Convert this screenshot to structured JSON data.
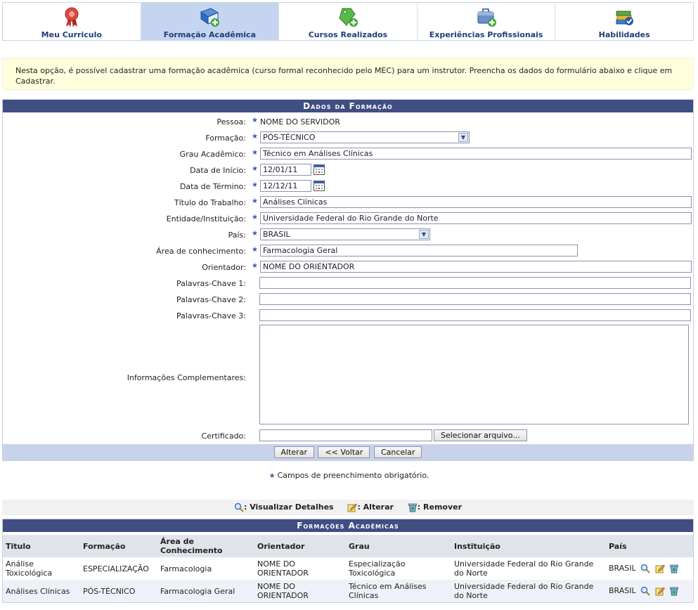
{
  "tabs": [
    {
      "label": "Meu Curriculo",
      "icon": "ribbon-award-icon",
      "active": false
    },
    {
      "label": "Formação Acadêmica",
      "icon": "book-add-icon",
      "active": true
    },
    {
      "label": "Cursos Realizados",
      "icon": "tag-add-icon",
      "active": false
    },
    {
      "label": "Experiências Profissionais",
      "icon": "briefcase-add-icon",
      "active": false
    },
    {
      "label": "Habilidades",
      "icon": "books-check-icon",
      "active": false
    }
  ],
  "info_text": "Nesta opção, é possível cadastrar uma formação acadêmica (curso formal reconhecido pelo MEC) para um instrutor. Preencha os dados do formulário abaixo e clique em Cadastrar.",
  "form": {
    "title": "Dados da Formação",
    "pessoa_label": "Pessoa:",
    "pessoa_value": "NOME DO SERVIDOR",
    "formacao_label": "Formação:",
    "formacao_value": "PÓS-TÉCNICO",
    "grau_label": "Grau Acadêmico:",
    "grau_value": "Técnico em Análises Clínicas",
    "inicio_label": "Data de Início:",
    "inicio_value": "12/01/11",
    "termino_label": "Data de Término:",
    "termino_value": "12/12/11",
    "titulo_label": "Título do Trabalho:",
    "titulo_value": "Análises Clínicas",
    "entidade_label": "Entidade/Instituição:",
    "entidade_value": "Universidade Federal do Rio Grande do Norte",
    "pais_label": "País:",
    "pais_value": "BRASIL",
    "area_label": "Área de conhecimento:",
    "area_value": "Farmacologia Geral",
    "orientador_label": "Orientador:",
    "orientador_value": "NOME DO ORIENTADOR",
    "kw1_label": "Palavras-Chave 1:",
    "kw1_value": "",
    "kw2_label": "Palavras-Chave 2:",
    "kw2_value": "",
    "kw3_label": "Palavras-Chave 3:",
    "kw3_value": "",
    "info_label": "Informações Complementares:",
    "info_value": "",
    "cert_label": "Certificado:",
    "cert_button": "Selecionar arquivo...",
    "btn_alterar": "Alterar",
    "btn_voltar": "<< Voltar",
    "btn_cancelar": "Cancelar"
  },
  "required_note": "Campos de preenchimento obrigatório.",
  "legend": {
    "view": ": Visualizar Detalhes",
    "edit": ": Alterar",
    "remove": ": Remover"
  },
  "results": {
    "title": "Formações Acadêmicas",
    "headers": [
      "Titulo",
      "Formação",
      "Área de Conhecimento",
      "Orientador",
      "Grau",
      "Instituição",
      "País"
    ],
    "rows": [
      [
        "Análise Toxicológica",
        "ESPECIALIZAÇÃO",
        "Farmacologia",
        "NOME DO ORIENTADOR",
        "Especialização Toxicológica",
        "Universidade Federal do Rio Grande do Norte",
        "BRASIL"
      ],
      [
        "Análises Clínicas",
        "PÓS-TÉCNICO",
        "Farmacologia Geral",
        "NOME DO ORIENTADOR",
        "Técnico em Análises Clínicas",
        "Universidade Federal do Rio Grande do Norte",
        "BRASIL"
      ]
    ]
  },
  "colors": {
    "header_blue": "#404e82",
    "active_tab": "#c5d5ef",
    "info_bg": "#ffffdd"
  }
}
